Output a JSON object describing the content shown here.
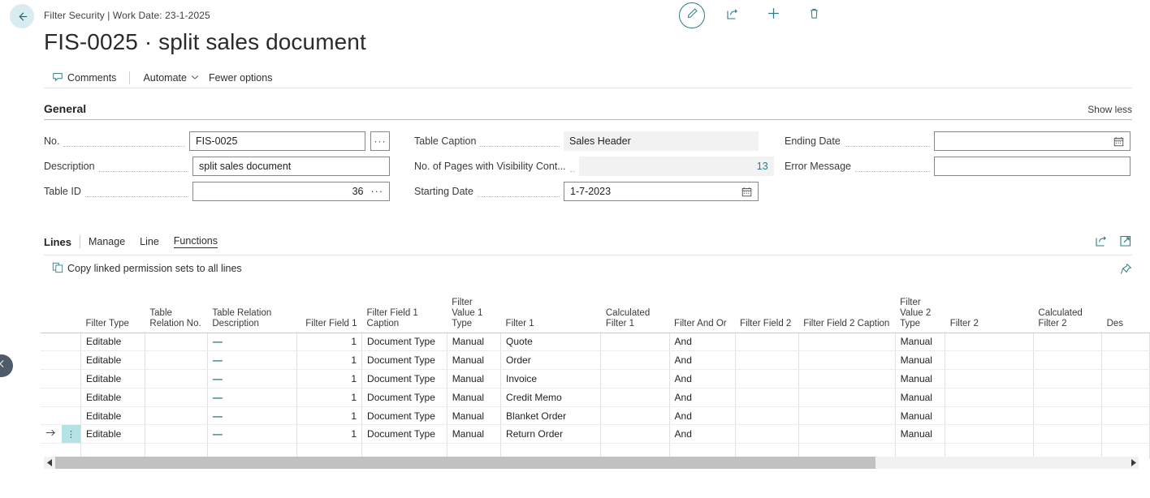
{
  "topbar": {
    "back_icon": "arrow-left-icon",
    "breadcrumb": "Filter Security | Work Date: 23-1-2025",
    "actions": [
      {
        "name": "edit-button",
        "icon": "pencil-icon"
      },
      {
        "name": "share-button",
        "icon": "share-icon"
      },
      {
        "name": "new-button",
        "icon": "plus-icon"
      },
      {
        "name": "delete-button",
        "icon": "trash-icon"
      }
    ]
  },
  "page": {
    "title": "FIS-0025 · split sales document"
  },
  "command_bar": {
    "comments": "Comments",
    "automate": "Automate",
    "fewer_options": "Fewer options"
  },
  "general": {
    "title": "General",
    "show_less": "Show less",
    "fields": {
      "no": {
        "label": "No.",
        "value": "FIS-0025"
      },
      "description": {
        "label": "Description",
        "value": "split sales document"
      },
      "table_id": {
        "label": "Table ID",
        "value": "36"
      },
      "table_caption": {
        "label": "Table Caption",
        "value": "Sales Header"
      },
      "no_of_pages": {
        "label": "No. of Pages with Visibility Cont...",
        "value": "13"
      },
      "starting_date": {
        "label": "Starting Date",
        "value": "1-7-2023"
      },
      "ending_date": {
        "label": "Ending Date",
        "value": ""
      },
      "error_message": {
        "label": "Error Message",
        "value": ""
      }
    }
  },
  "lines": {
    "title": "Lines",
    "tabs": [
      {
        "label": "Manage",
        "active": false
      },
      {
        "label": "Line",
        "active": false
      },
      {
        "label": "Functions",
        "active": true
      }
    ],
    "action": "Copy linked permission sets to all lines",
    "icons": [
      "share-icon",
      "open-in-new-icon",
      "pin-icon",
      "copy-icon"
    ],
    "columns": [
      "Filter Type",
      "Table Relation No.",
      "Table Relation Description",
      "Filter Field 1",
      "Filter Field 1 Caption",
      "Filter Value 1 Type",
      "Filter 1",
      "Calculated Filter 1",
      "Filter And Or",
      "Filter Field 2",
      "Filter Field 2 Caption",
      "Filter Value 2 Type",
      "Filter 2",
      "Calculated Filter 2",
      "Des"
    ],
    "rows": [
      {
        "selected": false,
        "filter_type": "Editable",
        "table_relation_no": "",
        "table_relation_description": "—",
        "filter_field_1": "1",
        "filter_field_1_caption": "Document Type",
        "filter_value_1_type": "Manual",
        "filter_1": "Quote",
        "calculated_filter_1": "",
        "filter_and_or": "And",
        "filter_field_2": "",
        "filter_field_2_caption": "",
        "filter_value_2_type": "Manual",
        "filter_2": "",
        "calculated_filter_2": "",
        "des": ""
      },
      {
        "selected": false,
        "filter_type": "Editable",
        "table_relation_no": "",
        "table_relation_description": "—",
        "filter_field_1": "1",
        "filter_field_1_caption": "Document Type",
        "filter_value_1_type": "Manual",
        "filter_1": "Order",
        "calculated_filter_1": "",
        "filter_and_or": "And",
        "filter_field_2": "",
        "filter_field_2_caption": "",
        "filter_value_2_type": "Manual",
        "filter_2": "",
        "calculated_filter_2": "",
        "des": ""
      },
      {
        "selected": false,
        "filter_type": "Editable",
        "table_relation_no": "",
        "table_relation_description": "—",
        "filter_field_1": "1",
        "filter_field_1_caption": "Document Type",
        "filter_value_1_type": "Manual",
        "filter_1": "Invoice",
        "calculated_filter_1": "",
        "filter_and_or": "And",
        "filter_field_2": "",
        "filter_field_2_caption": "",
        "filter_value_2_type": "Manual",
        "filter_2": "",
        "calculated_filter_2": "",
        "des": ""
      },
      {
        "selected": false,
        "filter_type": "Editable",
        "table_relation_no": "",
        "table_relation_description": "—",
        "filter_field_1": "1",
        "filter_field_1_caption": "Document Type",
        "filter_value_1_type": "Manual",
        "filter_1": "Credit Memo",
        "calculated_filter_1": "",
        "filter_and_or": "And",
        "filter_field_2": "",
        "filter_field_2_caption": "",
        "filter_value_2_type": "Manual",
        "filter_2": "",
        "calculated_filter_2": "",
        "des": ""
      },
      {
        "selected": false,
        "filter_type": "Editable",
        "table_relation_no": "",
        "table_relation_description": "—",
        "filter_field_1": "1",
        "filter_field_1_caption": "Document Type",
        "filter_value_1_type": "Manual",
        "filter_1": "Blanket Order",
        "calculated_filter_1": "",
        "filter_and_or": "And",
        "filter_field_2": "",
        "filter_field_2_caption": "",
        "filter_value_2_type": "Manual",
        "filter_2": "",
        "calculated_filter_2": "",
        "des": ""
      },
      {
        "selected": true,
        "filter_type": "Editable",
        "table_relation_no": "",
        "table_relation_description": "—",
        "filter_field_1": "1",
        "filter_field_1_caption": "Document Type",
        "filter_value_1_type": "Manual",
        "filter_1": "Return Order",
        "calculated_filter_1": "",
        "filter_and_or": "And",
        "filter_field_2": "",
        "filter_field_2_caption": "",
        "filter_value_2_type": "Manual",
        "filter_2": "",
        "calculated_filter_2": "",
        "des": ""
      }
    ]
  },
  "colors": {
    "accent": "#2e7d82",
    "selection": "#b5e2e4",
    "link": "#11767d",
    "back_pill": "#d9ecef",
    "peek": "#4f5a6b"
  }
}
